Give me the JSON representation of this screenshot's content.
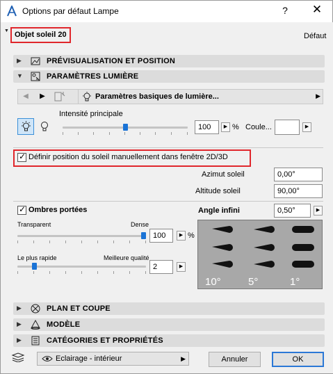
{
  "window": {
    "title": "Options par défaut Lampe",
    "help_label": "?",
    "close_label": "✕"
  },
  "header": {
    "object_name": "Objet soleil 20",
    "default_label": "Défaut"
  },
  "sections": {
    "preview": "PRÉVISUALISATION ET POSITION",
    "light_params": "PARAMÈTRES LUMIÈRE",
    "plan": "PLAN ET COUPE",
    "model": "MODÈLE",
    "categories": "CATÉGORIES ET PROPRIÉTÉS"
  },
  "toolbar": {
    "page_select": "Paramètres basiques de lumière..."
  },
  "intensity": {
    "label": "Intensité principale",
    "value": "100",
    "unit": "%",
    "color_label": "Coule...",
    "slider_fraction": 0.5
  },
  "sun_position": {
    "checkbox_label": "Définir position du soleil manuellement dans fenêtre 2D/3D",
    "checked": true,
    "azimut_label": "Azimut soleil",
    "azimut_value": "0,00°",
    "altitude_label": "Altitude soleil",
    "altitude_value": "90,00°"
  },
  "shadows": {
    "checkbox_label": "Ombres portées",
    "checked": true,
    "transparent_label": "Transparent",
    "dense_label": "Dense",
    "density_value": "100",
    "density_unit": "%",
    "density_fraction": 1.0,
    "fastest_label": "Le plus rapide",
    "best_label": "Meilleure qualité",
    "quality_value": "2",
    "quality_fraction": 0.12,
    "angle_label": "Angle infini",
    "angle_value": "0,50°",
    "preview_labels": [
      "10°",
      "5°",
      "1°"
    ]
  },
  "footer": {
    "view_select": "Eclairage - intérieur",
    "cancel_label": "Annuler",
    "ok_label": "OK"
  }
}
